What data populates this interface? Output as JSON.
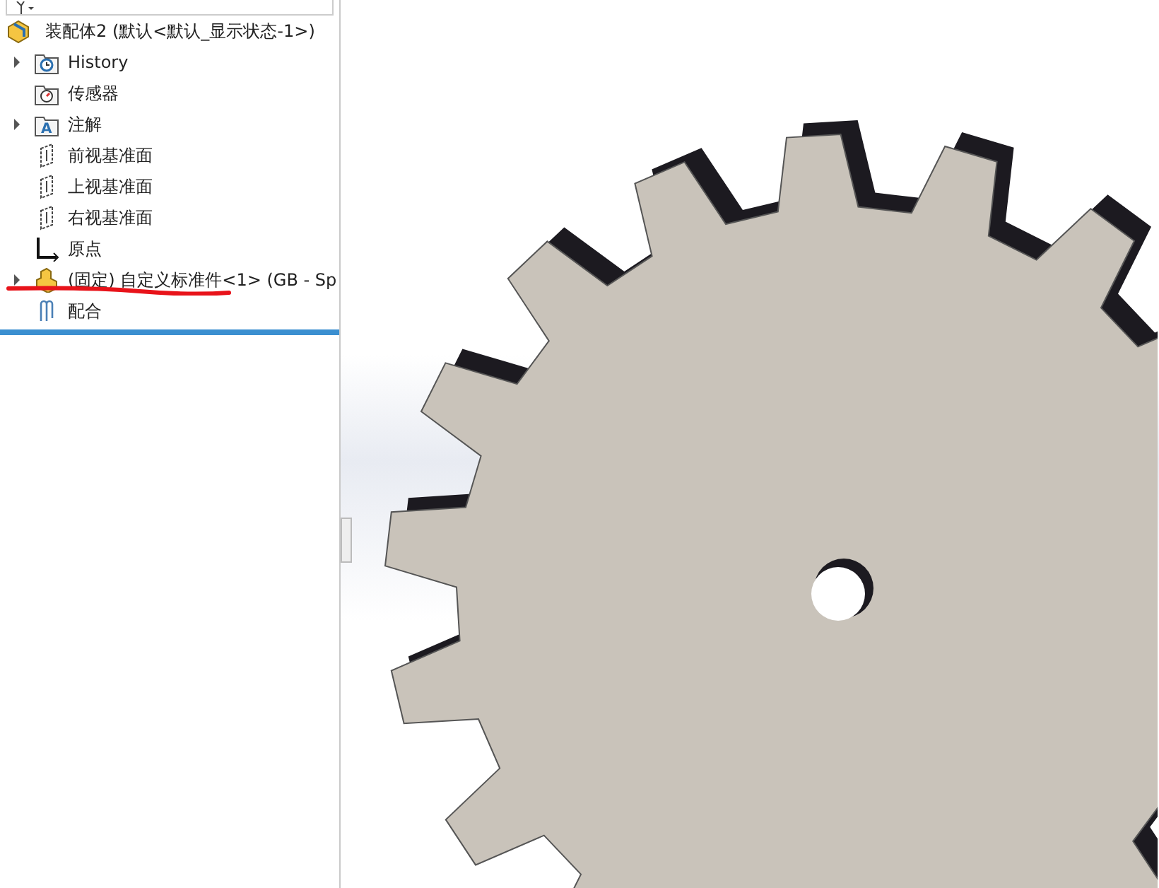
{
  "tree": {
    "root": "装配体2  (默认<默认_显示状态-1>)",
    "items": [
      {
        "kind": "history",
        "label": "History",
        "expandable": true
      },
      {
        "kind": "sensor",
        "label": "传感器",
        "expandable": false
      },
      {
        "kind": "annotation",
        "label": "注解",
        "expandable": true,
        "icon_text": "A"
      },
      {
        "kind": "plane",
        "label": "前视基准面",
        "expandable": false
      },
      {
        "kind": "plane",
        "label": "上视基准面",
        "expandable": false
      },
      {
        "kind": "plane",
        "label": "右视基准面",
        "expandable": false
      },
      {
        "kind": "origin",
        "label": "原点",
        "expandable": false
      },
      {
        "kind": "part",
        "label": "(固定) 自定义标准件<1> (GB - Sp",
        "expandable": true,
        "underlined": true
      },
      {
        "kind": "mates",
        "label": "配合",
        "expandable": false
      }
    ]
  }
}
